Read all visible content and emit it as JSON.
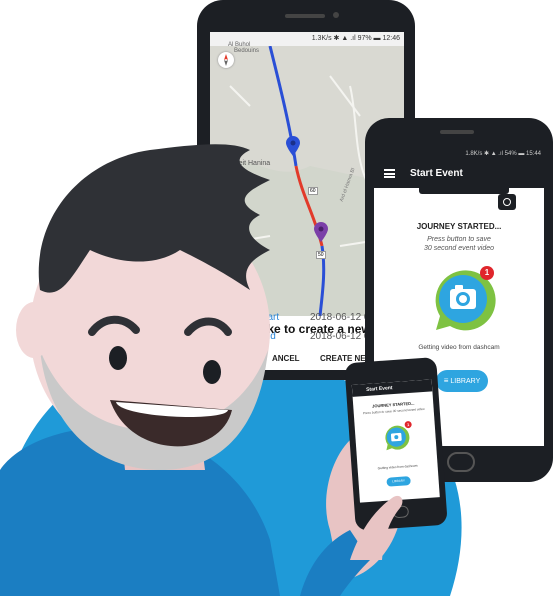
{
  "back_phone": {
    "status_text": "1.3K/s ✱ ▲ .ıl 97% ▬ 12:46",
    "map": {
      "labels": [
        "Al Buhol",
        "Bedouins",
        "Beit Hanina",
        "Ard el Hamra Bl"
      ],
      "route_markers": [
        "60",
        "50"
      ]
    },
    "dialog": {
      "title": "u like to create a new ev",
      "rows": [
        {
          "label": "Start",
          "value": "2018-06-12 0"
        },
        {
          "label": "End",
          "value": "2018-06-12 0"
        }
      ],
      "cancel_label": "ANCEL",
      "create_label": "CREATE NEW"
    }
  },
  "front_phone": {
    "status_text": "1.8K/s ✱ ▲ .ıl 54% ▬ 15:44",
    "appbar_title": "Start Event",
    "journey_title": "JOURNEY STARTED...",
    "hint_line1": "Press button to save",
    "hint_line2": "30 second event video",
    "badge_count": "1",
    "getting_video": "Getting video from dashcam",
    "library_label": "LIBRARY"
  },
  "small_phone": {
    "appbar_title": "Start Event",
    "journey_title": "JOURNEY STARTED...",
    "hint": "Press button to save 30 second event video",
    "badge_count": "1",
    "getting_video": "Getting video from dashcam",
    "library_label": "LIBRARY"
  },
  "colors": {
    "accent_blue": "#2ea5e0",
    "badge_red": "#e0262c",
    "route_blue": "#2a4fd6",
    "route_red": "#e23a2a",
    "camera_green": "#7ec242",
    "phone_dark": "#1c1f24"
  }
}
